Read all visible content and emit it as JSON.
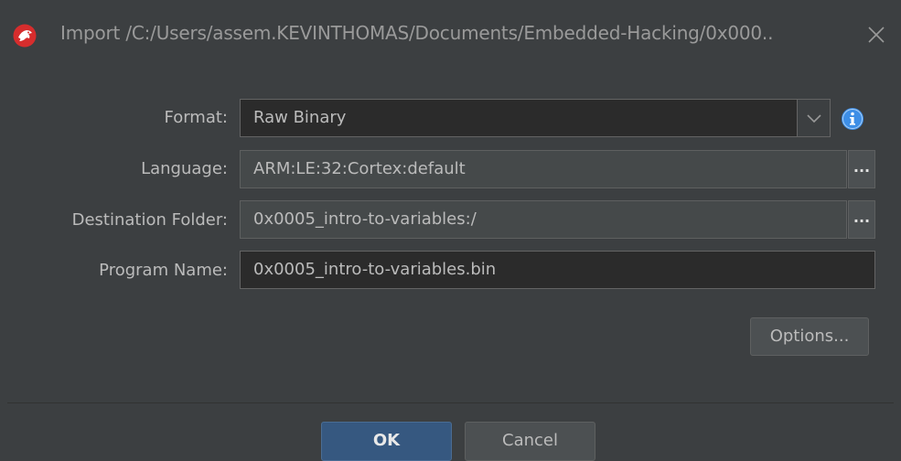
{
  "window": {
    "title": "Import /C:/Users/assem.KEVINTHOMAS/Documents/Embedded-Hacking/0x000..",
    "app_icon": "ghidra-dragon-icon",
    "close_icon": "close-icon"
  },
  "form": {
    "format": {
      "label": "Format:",
      "value": "Raw Binary"
    },
    "language": {
      "label": "Language:",
      "value": "ARM:LE:32:Cortex:default",
      "browse_label": "..."
    },
    "destination": {
      "label": "Destination Folder:",
      "value": "0x0005_intro-to-variables:/",
      "browse_label": "..."
    },
    "program_name": {
      "label": "Program Name:",
      "value": "0x0005_intro-to-variables.bin"
    },
    "options_label": "Options..."
  },
  "footer": {
    "ok_label": "OK",
    "cancel_label": "Cancel"
  },
  "colors": {
    "background": "#3c3f41",
    "field_bg": "#2b2b2b",
    "readonly_bg": "#45494a",
    "default_button": "#365880",
    "info_blue": "#3d8ee6",
    "app_icon_red": "#d62d2d"
  }
}
